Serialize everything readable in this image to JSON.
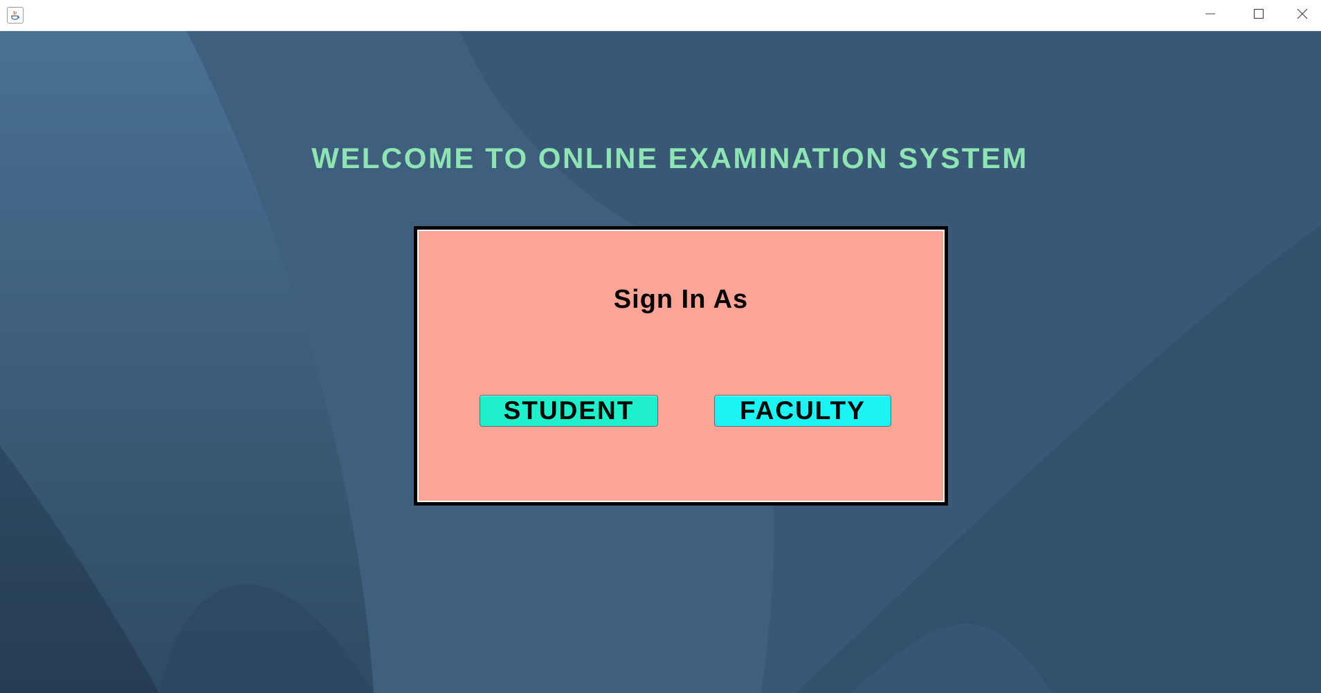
{
  "window": {
    "title": "",
    "icon": "java-app-icon",
    "controls": {
      "minimize_icon": "minimize-icon",
      "maximize_icon": "maximize-icon",
      "close_icon": "close-icon"
    }
  },
  "header": {
    "welcome_text": "WELCOME TO ONLINE EXAMINATION SYSTEM"
  },
  "signin_panel": {
    "heading": "Sign In As",
    "student_label": "STUDENT",
    "faculty_label": "FACULTY"
  },
  "colors": {
    "background": "#3a5875",
    "welcome_text": "#8fe4b3",
    "panel": "#fea496",
    "student_button": "#1ff0cc",
    "faculty_button": "#1cf3f5"
  }
}
